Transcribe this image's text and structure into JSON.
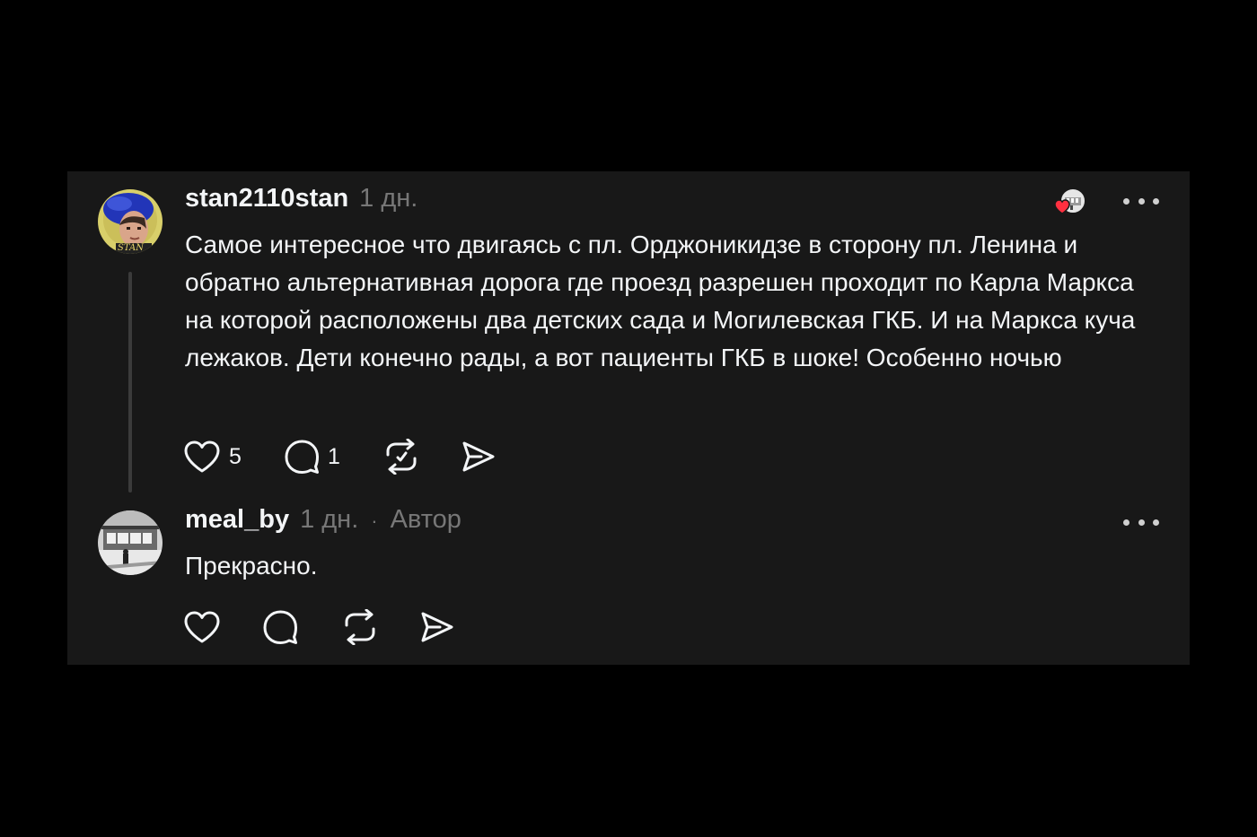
{
  "comments": [
    {
      "username": "stan2110stan",
      "time": "1 дн.",
      "avatar_text": "STAN",
      "text": "Самое интересное что двигаясь с пл. Орджоникидзе в сторону пл. Ленина и обратно альтернативная дорога где проезд разрешен проходит по Карла Маркса на которой расположены два детских сада и Могилевская ГКБ. И на Маркса куча лежаков. Дети конечно рады, а вот пациенты ГКБ в шоке! Особенно ночью",
      "likes": "5",
      "replies": "1",
      "liked_by_author": true
    },
    {
      "username": "meal_by",
      "time": "1 дн.",
      "separator": "·",
      "author_label": "Автор",
      "text": "Прекрасно."
    }
  ],
  "icons": {
    "like": "heart-icon",
    "reply": "speech-bubble-icon",
    "repost": "repost-icon",
    "share": "send-icon",
    "more": "more-horizontal-icon",
    "liked_badge": "author-liked-heart-icon"
  },
  "colors": {
    "background": "#000000",
    "card": "#181818",
    "text": "#f3f5f7",
    "muted": "#777777",
    "like_red": "#ff3040"
  }
}
